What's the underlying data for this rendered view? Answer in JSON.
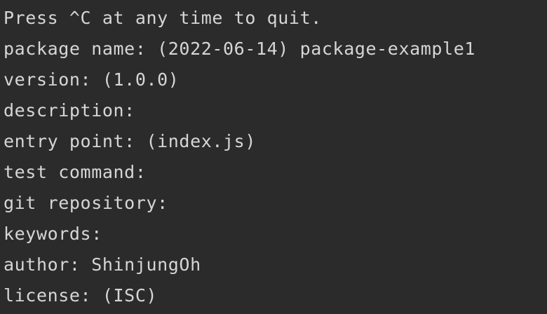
{
  "terminal": {
    "lines": [
      "Press ^C at any time to quit.",
      "package name: (2022-06-14) package-example1",
      "version: (1.0.0)",
      "description:",
      "entry point: (index.js)",
      "test command:",
      "git repository:",
      "keywords:",
      "author: ShinjungOh",
      "license: (ISC)"
    ]
  },
  "colors": {
    "background": "#2b2b2b",
    "text": "#d6d6d6"
  }
}
